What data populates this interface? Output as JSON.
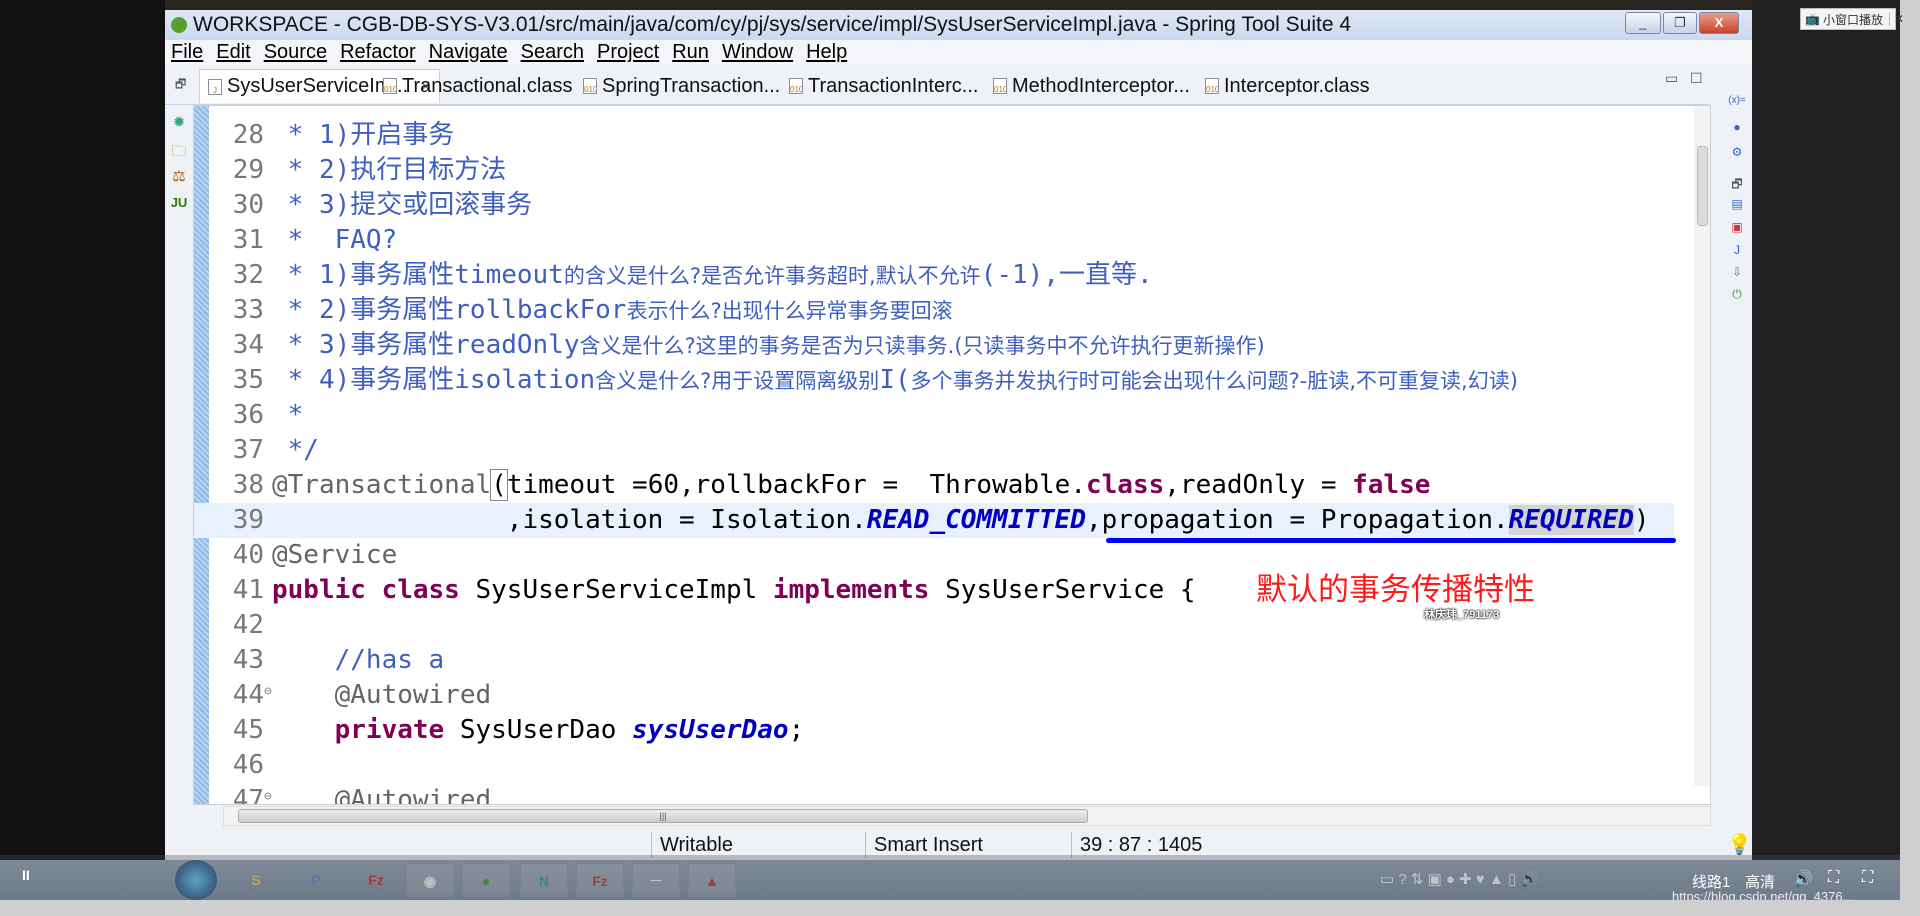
{
  "window": {
    "title": "WORKSPACE - CGB-DB-SYS-V3.01/src/main/java/com/cy/pj/sys/service/impl/SysUserServiceImpl.java - Spring Tool Suite 4",
    "minimize": "_",
    "restore": "❐",
    "close": "X"
  },
  "menu": [
    "File",
    "Edit",
    "Source",
    "Refactor",
    "Navigate",
    "Search",
    "Project",
    "Run",
    "Window",
    "Help"
  ],
  "tabs": [
    {
      "label": "SysUserServiceIm...",
      "close": "✕",
      "active": true
    },
    {
      "label": "Transactional.class"
    },
    {
      "label": "SpringTransaction..."
    },
    {
      "label": "TransactionInterc..."
    },
    {
      "label": "MethodInterceptor..."
    },
    {
      "label": "Interceptor.class"
    }
  ],
  "code": [
    {
      "n": "28",
      "s": [
        [
          "cm",
          " * "
        ],
        [
          "cm",
          "1)开启事务"
        ]
      ]
    },
    {
      "n": "29",
      "s": [
        [
          "cm",
          " * "
        ],
        [
          "cm",
          "2)执行目标方法"
        ]
      ]
    },
    {
      "n": "30",
      "s": [
        [
          "cm",
          " * "
        ],
        [
          "cm",
          "3)提交或回滚事务"
        ]
      ]
    },
    {
      "n": "31",
      "s": [
        [
          "cm",
          " *  FAQ?"
        ]
      ]
    },
    {
      "n": "32",
      "s": [
        [
          "cm",
          " * 1)事务属性timeout"
        ],
        [
          "cms",
          "的含义是什么?是否允许事务超时,默认不允许"
        ],
        [
          "cm",
          "(-1),一直等."
        ]
      ]
    },
    {
      "n": "33",
      "s": [
        [
          "cm",
          " * 2)事务属性rollbackFor"
        ],
        [
          "cms",
          "表示什么?出现什么异常事务要回滚"
        ]
      ]
    },
    {
      "n": "34",
      "s": [
        [
          "cm",
          " * 3)事务属性readOnly"
        ],
        [
          "cms",
          "含义是什么?这里的事务是否为只读事务.(只读事务中不允许执行更新操作)"
        ]
      ]
    },
    {
      "n": "35",
      "s": [
        [
          "cm",
          " * 4)事务属性isolation"
        ],
        [
          "cms",
          "含义是什么?用于设置隔离级别"
        ],
        [
          "cm",
          "I("
        ],
        [
          "cms",
          "多个事务并发执行时可能会出现什么问题?-脏读,不可重复读,幻读)"
        ]
      ]
    },
    {
      "n": "36",
      "s": [
        [
          "cm",
          " *"
        ]
      ]
    },
    {
      "n": "37",
      "s": [
        [
          "cm",
          " */"
        ]
      ]
    },
    {
      "n": "38",
      "s": [
        [
          "an",
          "@Transactional"
        ],
        [
          "pl br",
          "("
        ],
        [
          "pl",
          "timeout =60,rollbackFor =  Throwable."
        ],
        [
          "kw",
          "class"
        ],
        [
          "pl",
          ",readOnly = "
        ],
        [
          "kw",
          "false"
        ]
      ]
    },
    {
      "n": "39",
      "hl": true,
      "s": [
        [
          "pl",
          "               ,isolation = Isolation."
        ],
        [
          "cst",
          "READ_COMMITTED"
        ],
        [
          "pl",
          ",propagation = Propagation."
        ],
        [
          "cst sel",
          "REQUIRED"
        ],
        [
          "pl",
          ")"
        ]
      ]
    },
    {
      "n": "40",
      "s": [
        [
          "an",
          "@Service"
        ]
      ]
    },
    {
      "n": "41",
      "s": [
        [
          "kw",
          "public class "
        ],
        [
          "pl",
          "SysUserServiceImpl "
        ],
        [
          "kw",
          "implements "
        ],
        [
          "pl",
          "SysUserService {"
        ]
      ]
    },
    {
      "n": "42",
      "s": []
    },
    {
      "n": "43",
      "s": [
        [
          "cm",
          "    //has a"
        ]
      ]
    },
    {
      "n": "44",
      "fold": true,
      "s": [
        [
          "an",
          "    @Autowired"
        ]
      ]
    },
    {
      "n": "45",
      "s": [
        [
          "kw",
          "    private "
        ],
        [
          "pl",
          "SysUserDao "
        ],
        [
          "cst",
          "sysUserDao"
        ],
        [
          "pl",
          ";"
        ]
      ]
    },
    {
      "n": "46",
      "s": []
    },
    {
      "n": "47",
      "fold": true,
      "s": [
        [
          "an",
          "    @Autowired"
        ]
      ]
    }
  ],
  "annotation": {
    "text": "默认的事务传播特性",
    "color": "#ff1a1a",
    "underline_color": "#0000ff"
  },
  "watermark_user": "林庆玮_791173",
  "status": {
    "writable": "Writable",
    "insert_mode": "Smart Insert",
    "position": "39 : 87 : 1405"
  },
  "player": {
    "pause": "II",
    "route": "线路1",
    "quality": "高清",
    "popup": "小窗口播放",
    "popup_close": "✕"
  },
  "url_watermark": "https://blog.csdn.net/qq_4376...",
  "colors": {
    "comment": "#3f5fbf",
    "keyword": "#7f0055",
    "annotation": "#646464",
    "constant": "#0000c0",
    "current_line": "#e8f2fe"
  }
}
